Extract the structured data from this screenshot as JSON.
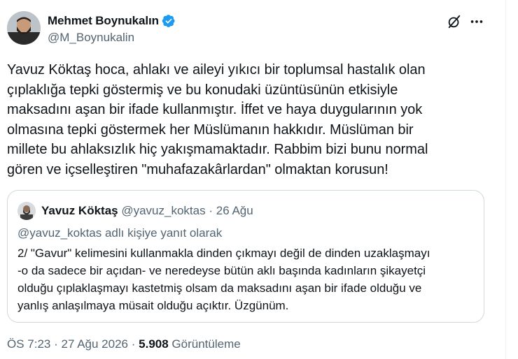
{
  "author": {
    "name": "Mehmet Boynukalın",
    "handle": "@M_Boynukalin"
  },
  "tweet": {
    "text": "Yavuz Köktaş hoca, ahlakı ve aileyi yıkıcı bir toplumsal hastalık olan\nçıplaklığa tepki göstermiş ve bu konudaki üzüntüsünün etkisiyle\nmaksadını aşan bir ifade kullanmıştır. İffet ve haya duygularının yok\nolmasına tepki göstermek her Müslümanın hakkıdır. Müslüman bir\nmillete bu ahlaksızlık hiç yakışmamaktadır. Rabbim bizi bunu normal\ngören ve içselleştiren \"muhafazakârlardan\" olmaktan korusun!"
  },
  "quote": {
    "name": "Yavuz Köktaş",
    "handle": "@yavuz_koktas",
    "separator": "·",
    "date": "26 Ağu",
    "reply_to": "@yavuz_koktas adlı kişiye yanıt olarak",
    "text": "2/ \"Gavur\" kelimesini kullanmakla dinden çıkmayı değil de dinden uzaklaşmayı\n-o da sadece bir açıdan- ve neredeyse bütün aklı başında kadınların şikayetçi\nolduğu çıplaklaşmayı kastetmiş olsam da maksadını aşan bir ifade olduğu ve\nyanlış anlaşılmaya müsait olduğu açıktır. Üzgünüm."
  },
  "footer": {
    "time": "ÖS 7:23",
    "separator": "·",
    "date": "27 Ağu 2026",
    "views_count": "5.908",
    "views_label": "Görüntüleme"
  },
  "icons": {
    "verified": "verified-badge-icon",
    "grok": "grok-icon",
    "more": "more-icon"
  },
  "colors": {
    "verified": "#1d9bf0",
    "secondary_text": "#536471",
    "border": "#cfd9de"
  }
}
